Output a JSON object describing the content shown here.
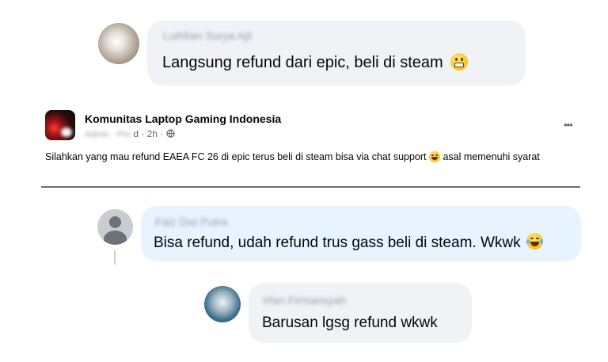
{
  "comments": [
    {
      "author_blurred": "Luthfian Surya Ajil",
      "text": "Langsung refund dari epic, beli di steam",
      "emoji": "grimacing-face-icon"
    },
    {
      "author_blurred": "Faiz Dwi Putra",
      "text": "Bisa refund, udah refund trus gass beli di steam. Wkwk",
      "emoji": "laughing-tears-icon"
    },
    {
      "author_blurred": "Irfan Firmansyah",
      "text": "Barusan lgsg refund wkwk",
      "emoji": ""
    }
  ],
  "post": {
    "group_name": "Komunitas Laptop Gaming Indonesia",
    "meta_blurred": "Admin · Pinned",
    "meta_visible": "d · 2h ·",
    "audience_icon": "globe-icon",
    "more_label": "•••",
    "body_part1": "Silahkan yang mau refund EAEA FC 26 di epic terus beli di steam bisa via chat support",
    "body_part2": "asal memenuhi syarat"
  },
  "colors": {
    "bubble_grey": "#f0f2f5",
    "bubble_blue": "#e7f3ff",
    "text": "#050505",
    "meta": "#65676b",
    "divider": "#6e6e6e"
  }
}
